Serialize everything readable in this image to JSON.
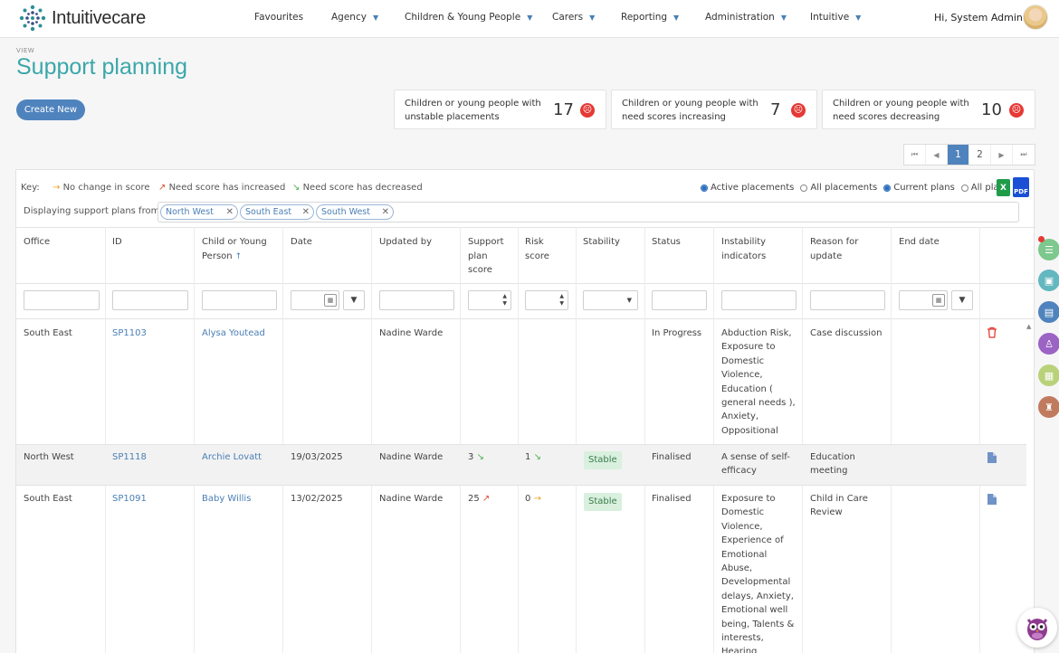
{
  "brand": {
    "name": "Intuitivecare"
  },
  "nav": {
    "items": [
      {
        "label": "Favourites",
        "has_menu": false
      },
      {
        "label": "Agency",
        "has_menu": true
      },
      {
        "label": "Children & Young People",
        "has_menu": true
      },
      {
        "label": "Carers",
        "has_menu": true
      },
      {
        "label": "Reporting",
        "has_menu": true
      },
      {
        "label": "Administration",
        "has_menu": true
      },
      {
        "label": "Intuitive",
        "has_menu": true
      }
    ],
    "user_greeting": "Hi, System Admin"
  },
  "page": {
    "view_label": "VIEW",
    "title": "Support planning",
    "create_button": "Create New"
  },
  "stats": [
    {
      "label_line1": "Children or young people with",
      "label_line2": "unstable placements",
      "value": "17",
      "icon": "sad-face-icon"
    },
    {
      "label_line1": "Children or young people with",
      "label_line2": "need scores increasing",
      "value": "7",
      "icon": "sad-face-icon"
    },
    {
      "label_line1": "Children or young people with",
      "label_line2": "need scores decreasing",
      "value": "10",
      "icon": "sad-face-icon"
    }
  ],
  "pager": {
    "first": "⏮",
    "prev": "◀",
    "pages": [
      "1",
      "2"
    ],
    "active_page": "1",
    "next": "▶",
    "last": "⏭"
  },
  "key": {
    "label": "Key:",
    "no_change": "No change in score",
    "increased": "Need score has increased",
    "decreased": "Need score has decreased"
  },
  "placement_filter": {
    "options": [
      {
        "label": "Active placements",
        "selected": true
      },
      {
        "label": "All placements",
        "selected": false
      },
      {
        "label": "Current plans",
        "selected": true
      },
      {
        "label": "All plans",
        "selected": false
      }
    ]
  },
  "export": {
    "excel": "X",
    "pdf": "PDF"
  },
  "office_filter": {
    "label": "Displaying support plans from",
    "chips": [
      "North West",
      "South East",
      "South West"
    ]
  },
  "table": {
    "columns": {
      "office": "Office",
      "id": "ID",
      "child_1": "Child or Young",
      "child_2": "Person",
      "date": "Date",
      "updated_by": "Updated by",
      "score_1": "Support",
      "score_2": "plan",
      "score_3": "score",
      "risk_1": "Risk",
      "risk_2": "score",
      "stability": "Stability",
      "status": "Status",
      "instab_1": "Instability",
      "instab_2": "indicators",
      "reason_1": "Reason for",
      "reason_2": "update",
      "end_date": "End date"
    },
    "rows": [
      {
        "office": "South East",
        "id": "SP1103",
        "child": "Alysa Youtead",
        "date": "",
        "updated_by": "Nadine Warde",
        "support_score": "",
        "support_trend": "",
        "risk_score": "",
        "risk_trend": "",
        "stability": "",
        "status": "In Progress",
        "indicators": [
          "Abduction Risk,",
          "Exposure to",
          "Domestic",
          "Violence,",
          "Education (",
          "general needs ),",
          "Anxiety,",
          "Oppositional"
        ],
        "reason": [
          "Case discussion"
        ],
        "end_date": "",
        "action": "delete-icon"
      },
      {
        "office": "North West",
        "id": "SP1118",
        "child": "Archie Lovatt",
        "date": "19/03/2025",
        "updated_by": "Nadine Warde",
        "support_score": "3",
        "support_trend": "↘",
        "risk_score": "1",
        "risk_trend": "↘",
        "stability": "Stable",
        "status": "Finalised",
        "indicators": [
          "A sense of self-",
          "efficacy"
        ],
        "reason": [
          "Education",
          "meeting"
        ],
        "end_date": "",
        "action": "pdf-doc-icon"
      },
      {
        "office": "South East",
        "id": "SP1091",
        "child": "Baby Willis",
        "date": "13/02/2025",
        "updated_by": "Nadine Warde",
        "support_score": "25",
        "support_trend": "↗",
        "risk_score": "0",
        "risk_trend": "→",
        "stability": "Stable",
        "status": "Finalised",
        "indicators": [
          "Exposure to",
          "Domestic",
          "Violence,",
          "Experience of",
          "Emotional",
          "Abuse,",
          "Developmental",
          "delays, Anxiety,",
          "Emotional well",
          "being, Talents &",
          "interests,",
          "Hearing"
        ],
        "reason": [
          "Child in Care",
          "Review"
        ],
        "end_date": "",
        "action": "pdf-doc-icon"
      }
    ]
  },
  "colors": {
    "title_teal": "#3ba7a8",
    "primary_blue": "#4f83bd",
    "link_blue": "#4a7fb5",
    "alert_red": "#e53935",
    "stable_green_bg": "#d9f0df",
    "trend_orange": "#f0a020",
    "trend_red": "#e2502d",
    "trend_green": "#4caf50"
  },
  "right_rail": [
    "list-icon",
    "briefcase-icon",
    "document-icon",
    "person-icon",
    "calendar-icon",
    "stamp-icon"
  ]
}
